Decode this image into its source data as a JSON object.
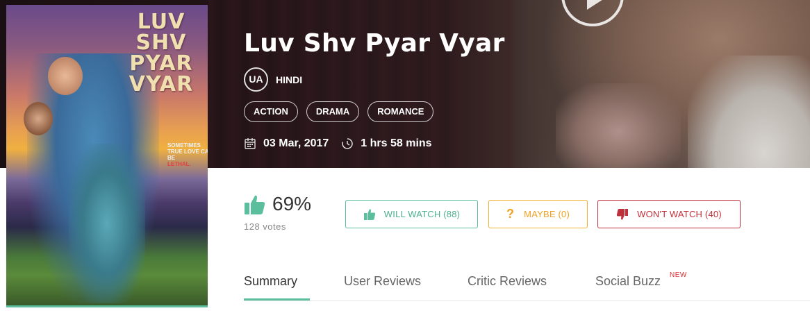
{
  "movie": {
    "title": "Luv Shv Pyar Vyar",
    "certification": "UA",
    "language": "HINDI",
    "genres": [
      "ACTION",
      "DRAMA",
      "ROMANCE"
    ],
    "release_date": "03 Mar, 2017",
    "duration": "1 hrs 58 mins"
  },
  "poster": {
    "title_lines": [
      "LUV",
      "SHV",
      "PYAR",
      "VYAR"
    ],
    "tagline_lines": [
      "SOMETIMES",
      "TRUE LOVE CAN BE"
    ],
    "tagline_accent": "LETHAL."
  },
  "rating": {
    "percent": "69%",
    "votes": "128 votes"
  },
  "actions": {
    "will_watch": "WILL WATCH (88)",
    "maybe": "MAYBE (0)",
    "maybe_glyph": "?",
    "wont_watch": "WON'T WATCH (40)"
  },
  "tabs": {
    "summary": "Summary",
    "user_reviews": "User Reviews",
    "critic_reviews": "Critic Reviews",
    "social_buzz": "Social Buzz",
    "new_badge": "NEW"
  },
  "colors": {
    "accent_green": "#5bbf9e",
    "maybe_orange": "#f0a020",
    "wont_red": "#c0303a"
  },
  "icons": [
    "play-icon",
    "calendar-icon",
    "clock-icon",
    "thumbs-up-icon",
    "question-icon",
    "thumbs-down-icon"
  ]
}
